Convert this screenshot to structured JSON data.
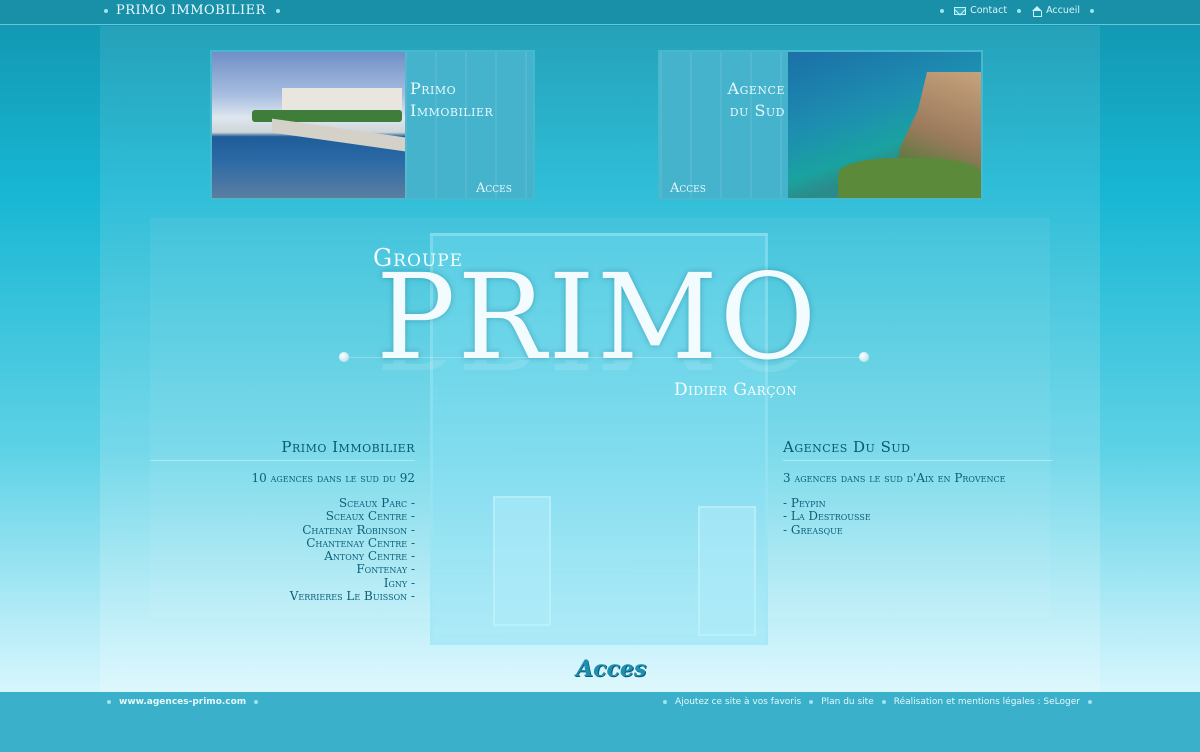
{
  "topbar": {
    "brand": "PRIMO IMMOBILIER",
    "contact": "Contact",
    "home": "Accueil"
  },
  "banners": {
    "left": {
      "title_line1": "Primo",
      "title_line2": "Immobilier",
      "access": "Acces"
    },
    "right": {
      "title_line1": "Agence",
      "title_line2": "du Sud",
      "access": "Acces"
    }
  },
  "logo": {
    "groupe": "Groupe",
    "primo": "PRIMO",
    "subtitle": "Didier Garçon"
  },
  "left_column": {
    "heading": "Primo Immobilier",
    "subtitle": "10 agences dans le sud du 92",
    "items": [
      "Sceaux Parc -",
      "Sceaux Centre -",
      "Chatenay Robinson -",
      "Chantenay Centre -",
      "Antony Centre -",
      "Fontenay -",
      "Igny -",
      "Verrieres Le Buisson -"
    ]
  },
  "right_column": {
    "heading": "Agences Du Sud",
    "subtitle": "3 agences dans le sud d'Aix en Provence",
    "items": [
      "- Peypin",
      "- La Destrousse",
      "- Greasque"
    ]
  },
  "main_access": "Acces",
  "footer": {
    "site": "www.agences-primo.com",
    "links": [
      "Ajoutez ce site à vos favoris",
      "Plan du site",
      "Réalisation et mentions légales : SeLoger"
    ]
  }
}
